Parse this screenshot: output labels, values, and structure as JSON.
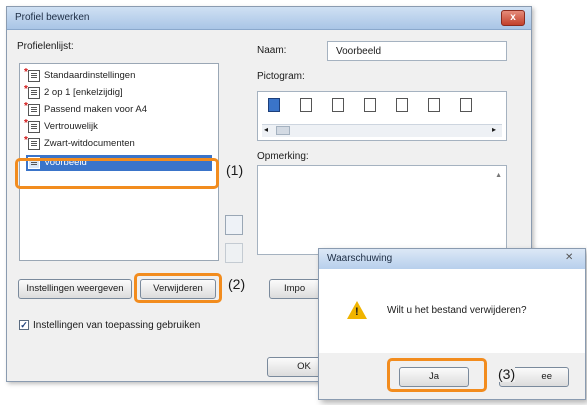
{
  "dialog": {
    "title": "Profiel bewerken",
    "close_label": "x",
    "profile_list_label": "Profielenlijst:",
    "profiles": [
      "Standaardinstellingen",
      "2 op 1 [enkelzijdig]",
      "Passend maken voor A4",
      "Vertrouwelijk",
      "Zwart-witdocumenten",
      "Voorbeeld"
    ],
    "selected_profile": "Voorbeeld",
    "name_label": "Naam:",
    "name_value": "Voorbeeld",
    "pictogram_label": "Pictogram:",
    "comment_label": "Opmerking:",
    "show_settings_button": "Instellingen weergeven",
    "delete_button": "Verwijderen",
    "import_button": "Impo",
    "use_settings_checkbox_label": "Instellingen van toepassing gebruiken",
    "use_settings_checked": true,
    "ok_button": "OK"
  },
  "warning": {
    "title": "Waarschuwing",
    "close_label": "✕",
    "message": "Wilt u het bestand verwijderen?",
    "yes_button": "Ja",
    "no_button": "ee"
  },
  "callouts": {
    "c1": "(1)",
    "c2": "(2)",
    "c3": "(3)"
  },
  "accent_colors": {
    "highlight": "#f28c1e",
    "selection": "#3a74c9",
    "warning_icon": "#f0b400"
  }
}
